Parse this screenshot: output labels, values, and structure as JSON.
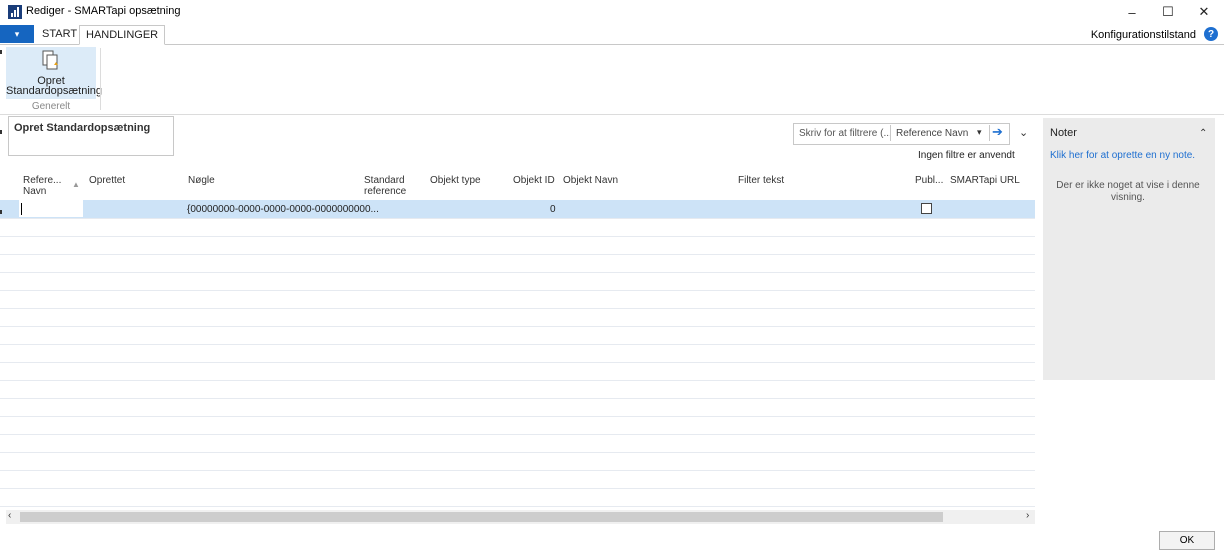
{
  "window": {
    "title": "Rediger - SMARTapi opsætning",
    "minimize": "–",
    "maximize": "☐",
    "close": "✕"
  },
  "ribbon": {
    "file_menu": "▾",
    "tabs": [
      {
        "label": "START",
        "active": false
      },
      {
        "label": "HANDLINGER",
        "active": true
      }
    ],
    "config_mode": "Konfigurationstilstand",
    "help": "?",
    "action_label_line1": "Opret",
    "action_label_line2": "Standardopsætning",
    "group_label": "Generelt"
  },
  "infobox": {
    "title": "Opret Standardopsætning"
  },
  "filter": {
    "placeholder": "Skriv for at filtrere (...",
    "field": "Reference Navn",
    "status": "Ingen filtre er anvendt"
  },
  "table": {
    "columns": [
      {
        "line1": "Refere...",
        "line2": "Navn"
      },
      {
        "line1": "Oprettet",
        "line2": ""
      },
      {
        "line1": "Nøgle",
        "line2": ""
      },
      {
        "line1": "Standard",
        "line2": "reference"
      },
      {
        "line1": "Objekt type",
        "line2": ""
      },
      {
        "line1": "Objekt ID",
        "line2": ""
      },
      {
        "line1": "Objekt Navn",
        "line2": ""
      },
      {
        "line1": "Filter tekst",
        "line2": ""
      },
      {
        "line1": "Publ...",
        "line2": ""
      },
      {
        "line1": "SMARTapi URL",
        "line2": ""
      }
    ],
    "sort_indicator": "▲",
    "rows": [
      {
        "key": "{00000000-0000-0000-0000-0000000000...",
        "object_id": "0",
        "published": false
      }
    ]
  },
  "notes": {
    "title": "Noter",
    "link": "Klik her for at oprette en ny note.",
    "empty": "Der er ikke noget at vise i denne visning."
  },
  "buttons": {
    "ok": "OK"
  },
  "colors": {
    "accent": "#1565c0",
    "selection": "#cde3f7",
    "link": "#1e6fd0"
  }
}
